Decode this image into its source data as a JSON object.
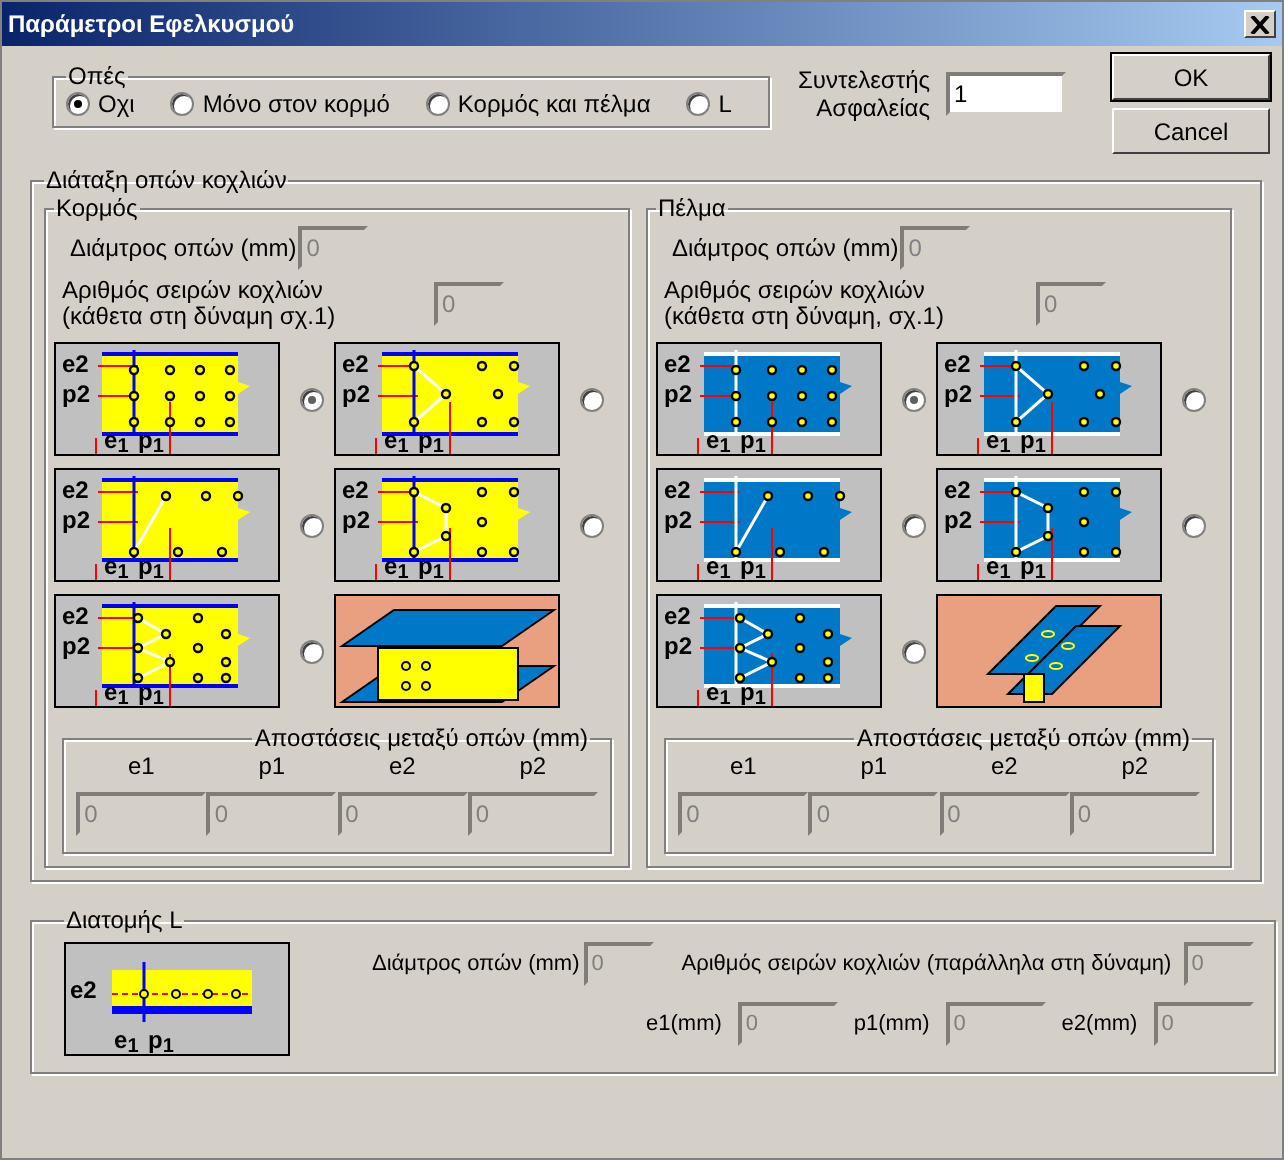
{
  "window": {
    "title": "Παράμετροι Εφελκυσμού"
  },
  "holes": {
    "legend": "Οπές",
    "options": [
      {
        "label": "Οχι",
        "selected": true
      },
      {
        "label": "Μόνο στον κορμό",
        "selected": false
      },
      {
        "label": "Κορμός και πέλμα",
        "selected": false
      },
      {
        "label": "L",
        "selected": false
      }
    ]
  },
  "safety_factor": {
    "label_lines": [
      "Συντελεστής",
      "Ασφαλείας"
    ],
    "value": "1"
  },
  "buttons": [
    {
      "label": "OK",
      "default": true
    },
    {
      "label": "Cancel",
      "default": false
    }
  ],
  "layout": {
    "legend": "Διάταξη οπών κοχλιών",
    "panels": [
      {
        "legend": "Κορμός",
        "color": "#ffff00",
        "diameter": {
          "label": "Διάμτρος οπών (mm)",
          "value": "0"
        },
        "rows": {
          "label_lines": [
            "Αριθμός σειρών κοχλιών",
            "(κάθετα στη δύναμη σχ.1)"
          ],
          "value": "0"
        },
        "patterns": [
          {
            "kind": "grid",
            "labels": [
              "e2",
              "p2",
              "e$_{1}$",
              "p$_{1}$"
            ],
            "selected": true
          },
          {
            "kind": "zigzag",
            "labels": [
              "e2",
              "p2",
              "e$_{1}$",
              "p$_{1}$"
            ],
            "selected": false
          },
          {
            "kind": "diagonal",
            "labels": [
              "e2",
              "p2",
              "e$_{1}$",
              "p$_{1}$"
            ],
            "selected": false
          },
          {
            "kind": "chevron",
            "labels": [
              "e2",
              "p2",
              "e$_{1}$",
              "p$_{1}$"
            ],
            "selected": false
          },
          {
            "kind": "staggered",
            "labels": [
              "e2",
              "p2",
              "e$_{1}$",
              "p$_{1}$"
            ],
            "selected": false
          },
          {
            "kind": "web-view"
          }
        ],
        "spacing": {
          "legend": "Αποστάσεις μεταξύ οπών (mm)",
          "fields": [
            {
              "label": "e1",
              "value": "0"
            },
            {
              "label": "p1",
              "value": "0"
            },
            {
              "label": "e2",
              "value": "0"
            },
            {
              "label": "p2",
              "value": "0"
            }
          ]
        }
      },
      {
        "legend": "Πέλμα",
        "color": "#0078c8",
        "diameter": {
          "label": "Διάμτρος οπών (mm)",
          "value": "0"
        },
        "rows": {
          "label_lines": [
            "Αριθμός σειρών κοχλιών",
            "(κάθετα στη δύναμη, σχ.1)"
          ],
          "value": "0"
        },
        "patterns": [
          {
            "kind": "grid",
            "labels": [
              "e2",
              "p2",
              "e$_{1}$",
              "p$_{1}$"
            ],
            "selected": true
          },
          {
            "kind": "zigzag",
            "labels": [
              "e2",
              "p2",
              "e$_{1}$",
              "p$_{1}$"
            ],
            "selected": false
          },
          {
            "kind": "diagonal",
            "labels": [
              "e2",
              "p2",
              "e$_{1}$",
              "p$_{1}$"
            ],
            "selected": false
          },
          {
            "kind": "chevron",
            "labels": [
              "e2",
              "p2",
              "e$_{1}$",
              "p$_{1}$"
            ],
            "selected": false
          },
          {
            "kind": "staggered",
            "labels": [
              "e2",
              "p2",
              "e$_{1}$",
              "p$_{1}$"
            ],
            "selected": false
          },
          {
            "kind": "flange-view"
          }
        ],
        "spacing": {
          "legend": "Αποστάσεις μεταξύ οπών (mm)",
          "fields": [
            {
              "label": "e1",
              "value": "0"
            },
            {
              "label": "p1",
              "value": "0"
            },
            {
              "label": "e2",
              "value": "0"
            },
            {
              "label": "p2",
              "value": "0"
            }
          ]
        }
      }
    ]
  },
  "angle": {
    "legend": "Διατομής L",
    "labels": [
      "e2",
      "e$_{1}$",
      "p$_{1}$"
    ],
    "diameter": {
      "label": "Διάμτρος οπών (mm)",
      "value": "0"
    },
    "rows": {
      "label": "Αριθμός σειρών κοχλιών (παράλληλα στη δύναμη)",
      "value": "0"
    },
    "fields": [
      {
        "label": "e1(mm)",
        "value": "0"
      },
      {
        "label": "p1(mm)",
        "value": "0"
      },
      {
        "label": "e2(mm)",
        "value": "0"
      }
    ]
  }
}
